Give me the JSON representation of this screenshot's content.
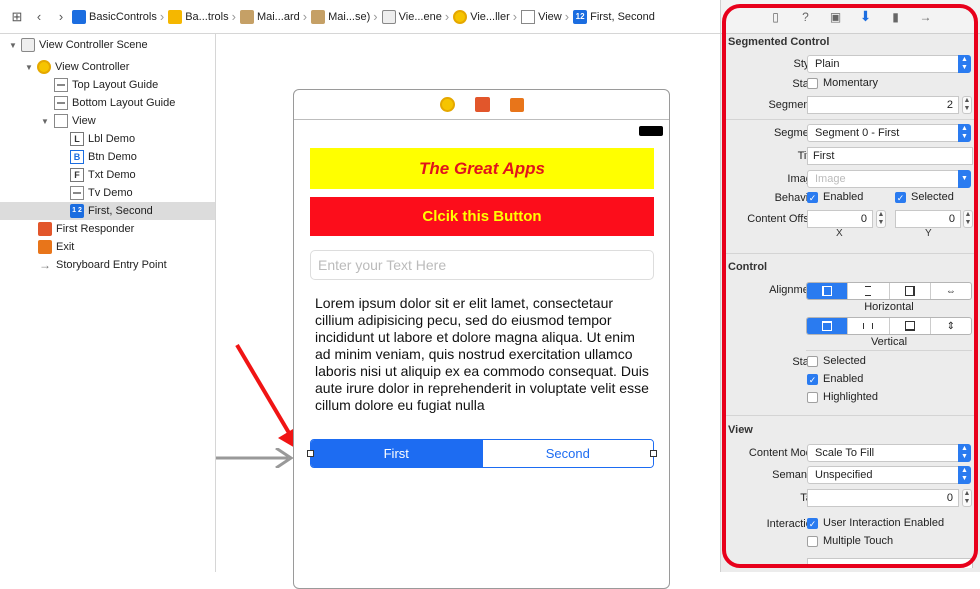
{
  "breadcrumbs": [
    "BasicControls",
    "Ba...trols",
    "Mai...ard",
    "Mai...se)",
    "Vie...ene",
    "Vie...ller",
    "View",
    "First, Second"
  ],
  "outline": {
    "items": [
      {
        "label": "View Controller Scene"
      },
      {
        "label": "View Controller"
      },
      {
        "label": "Top Layout Guide"
      },
      {
        "label": "Bottom Layout Guide"
      },
      {
        "label": "View"
      },
      {
        "label": "Lbl Demo",
        "letter": "L"
      },
      {
        "label": "Btn Demo",
        "letter": "B"
      },
      {
        "label": "Txt Demo",
        "letter": "F"
      },
      {
        "label": "Tv Demo"
      },
      {
        "label": "First, Second",
        "letter": "1 2"
      },
      {
        "label": "First Responder"
      },
      {
        "label": "Exit"
      },
      {
        "label": "Storyboard Entry Point"
      }
    ]
  },
  "canvas": {
    "label_text": "The Great Apps",
    "button_text": "Clcik this Button",
    "text_field_placeholder": "Enter your Text Here",
    "text_view_body": "Lorem ipsum dolor sit er elit lamet, consectetaur cillium adipisicing pecu, sed do eiusmod tempor incididunt ut labore et dolore magna aliqua. Ut enim ad minim veniam, quis nostrud exercitation ullamco laboris nisi ut aliquip ex ea commodo consequat. Duis aute irure dolor in reprehenderit in voluptate velit esse cillum dolore eu fugiat nulla",
    "segments": [
      "First",
      "Second"
    ]
  },
  "inspector": {
    "segmented_control": {
      "title": "Segmented Control",
      "style_label": "Style",
      "style_value": "Plain",
      "state_label": "State",
      "momentary_label": "Momentary",
      "segments_label": "Segments",
      "segments_value": "2",
      "segment_label": "Segment",
      "segment_value": "Segment 0 - First",
      "title_label": "Title",
      "title_value": "First",
      "image_label": "Image",
      "image_placeholder": "Image",
      "behavior_label": "Behavior",
      "enabled_label": "Enabled",
      "selected_label": "Selected",
      "content_offset_label": "Content Offset",
      "offset_x": "0",
      "offset_y": "0",
      "x_caption": "X",
      "y_caption": "Y"
    },
    "control": {
      "title": "Control",
      "alignment_label": "Alignment",
      "horizontal_caption": "Horizontal",
      "vertical_caption": "Vertical",
      "state_label": "State",
      "selected_label": "Selected",
      "enabled_label": "Enabled",
      "highlighted_label": "Highlighted"
    },
    "view": {
      "title": "View",
      "content_mode_label": "Content Mode",
      "content_mode_value": "Scale To Fill",
      "semantic_label": "Semantic",
      "semantic_value": "Unspecified",
      "tag_label": "Tag",
      "tag_value": "0",
      "interaction_label": "Interaction",
      "user_interaction_label": "User Interaction Enabled",
      "multiple_touch_label": "Multiple Touch"
    }
  },
  "colors": {
    "annotation_red": "#e8001b",
    "accent_blue": "#1d6cf2",
    "label_bg": "#ffff00",
    "button_bg": "#fc0d1b"
  }
}
